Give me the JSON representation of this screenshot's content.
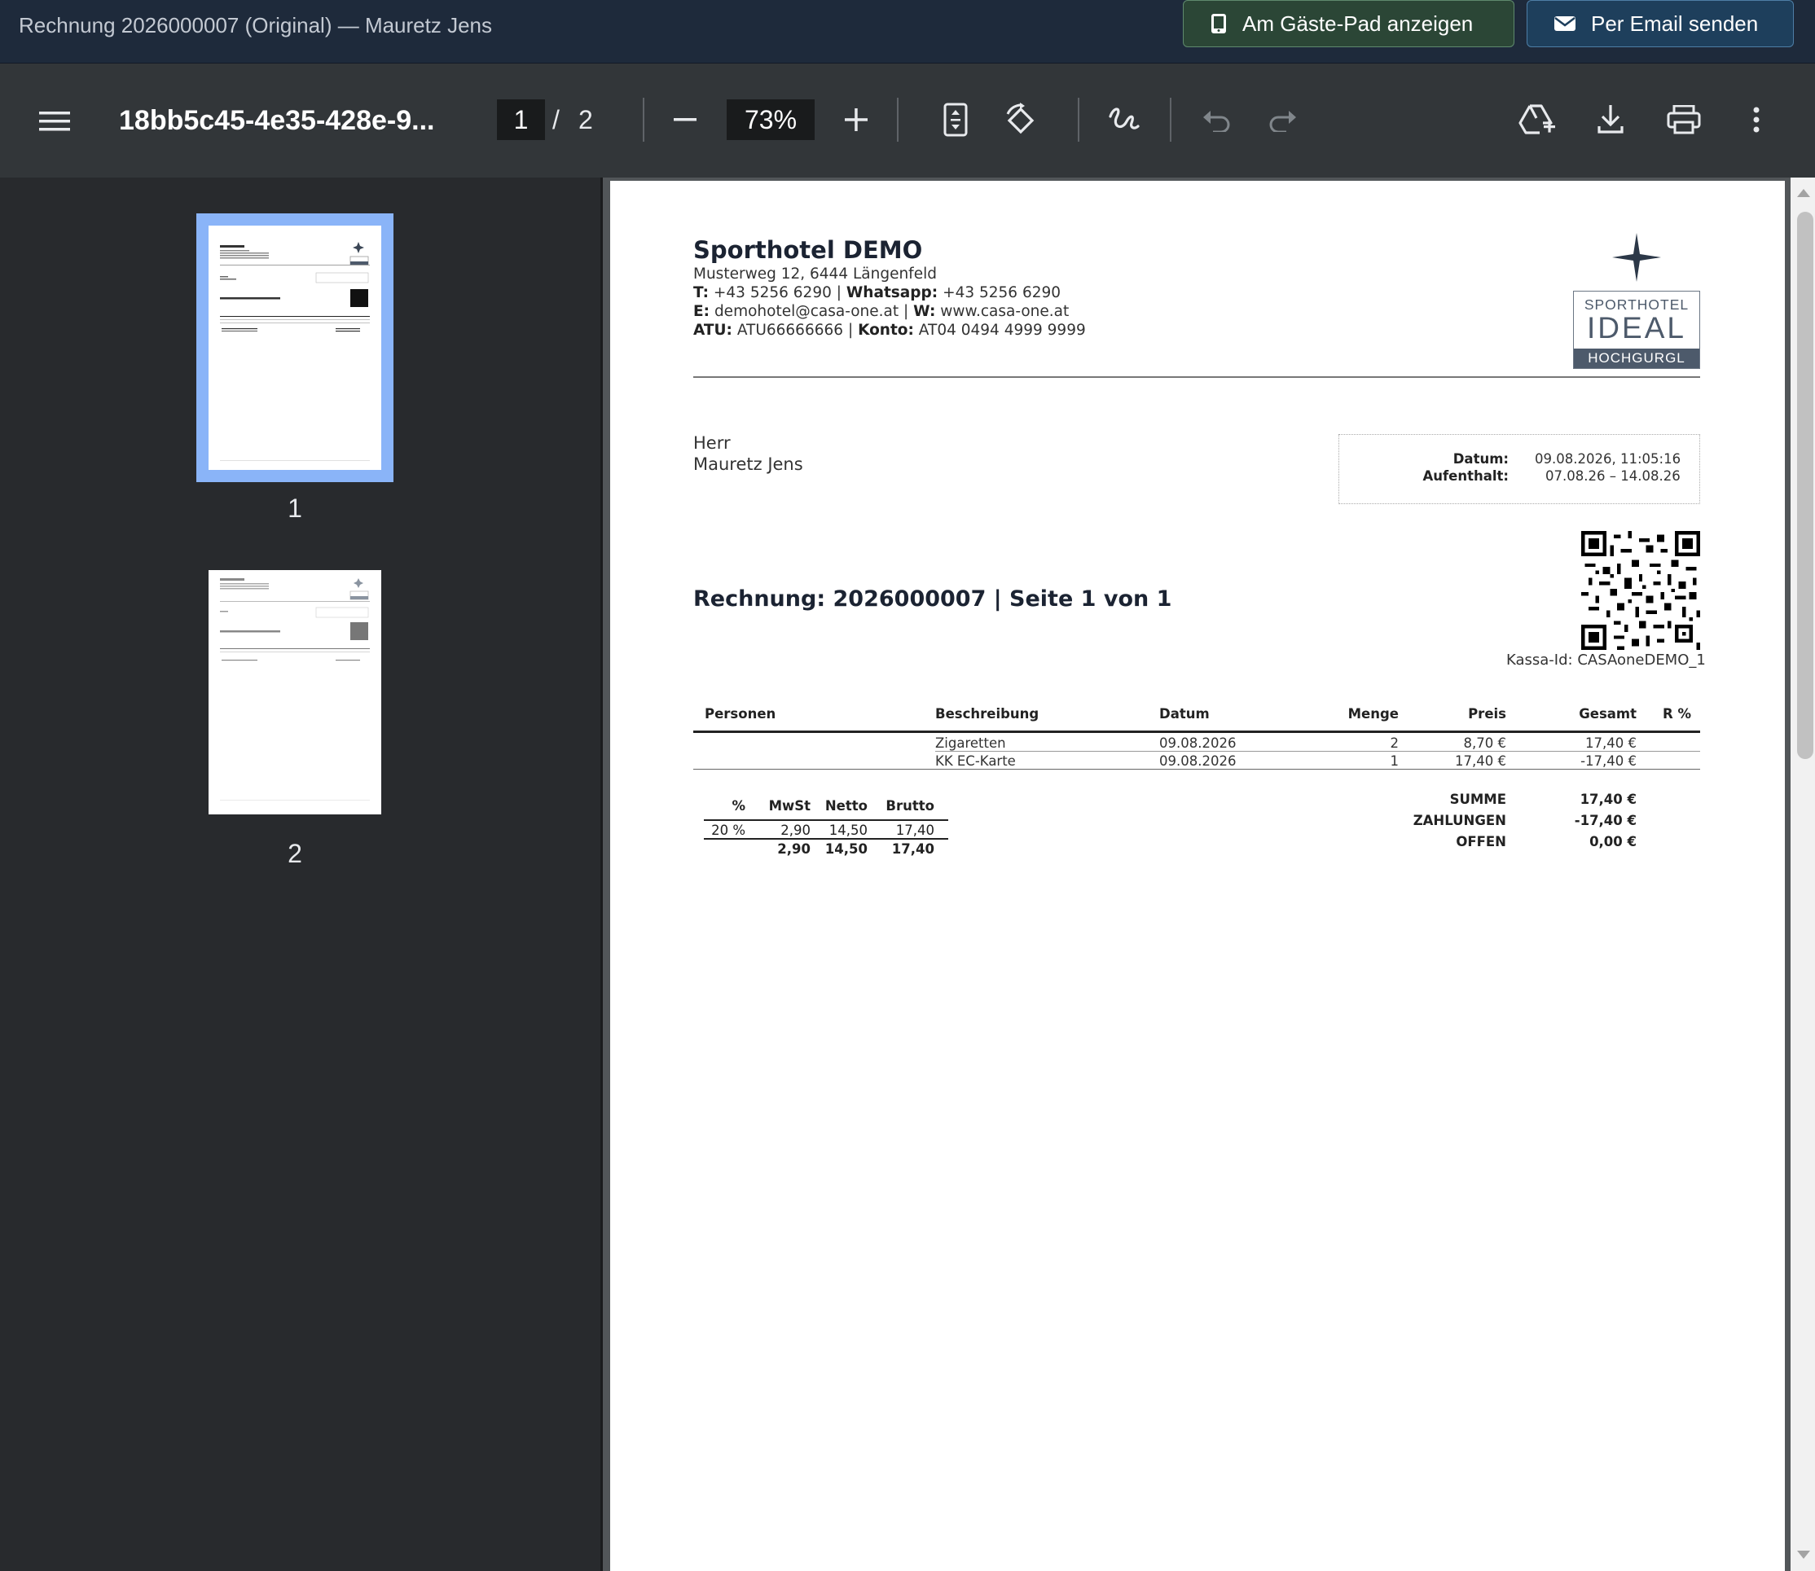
{
  "window": {
    "title": "Rechnung 2026000007 (Original) — Mauretz Jens",
    "buttons": {
      "guest_pad": "Am Gäste-Pad anzeigen",
      "email": "Per Email senden"
    }
  },
  "toolbar": {
    "doc_name": "18bb5c45-4e35-428e-9...",
    "current_page": "1",
    "page_separator": "/",
    "total_pages": "2",
    "zoom": "73%"
  },
  "sidebar": {
    "thumbnails": [
      {
        "label": "1",
        "selected": true
      },
      {
        "label": "2",
        "selected": false
      }
    ]
  },
  "invoice": {
    "hotel_name": "Sporthotel DEMO",
    "address": "Musterweg 12, 6444 Längenfeld",
    "phone_label": "T:",
    "phone": "+43 5256 6290",
    "whatsapp_label": "Whatsapp:",
    "whatsapp": "+43 5256 6290",
    "email_label": "E:",
    "email": "demohotel@casa-one.at",
    "web_label": "W:",
    "web": "www.casa-one.at",
    "atu_label": "ATU:",
    "atu": "ATU66666666",
    "konto_label": "Konto:",
    "konto": "AT04 0494 4999 9999",
    "sep": "|",
    "logo": {
      "line1": "SPORTHOTEL",
      "line2": "IDEAL",
      "line3": "HOCHGURGL"
    },
    "salutation": "Herr",
    "guest_name": "Mauretz Jens",
    "datum_label": "Datum:",
    "datum": "09.08.2026, 11:05:16",
    "aufenthalt_label": "Aufenthalt:",
    "aufenthalt": "07.08.26 – 14.08.26",
    "kassa": "Kassa-Id: CASAoneDEMO_1",
    "title": "Rechnung: 2026000007 | Seite 1 von 1",
    "columns": {
      "personen": "Personen",
      "beschreibung": "Beschreibung",
      "datum": "Datum",
      "menge": "Menge",
      "preis": "Preis",
      "gesamt": "Gesamt",
      "rabatt": "R %"
    },
    "rows": [
      {
        "personen": "",
        "beschreibung": "Zigaretten",
        "datum": "09.08.2026",
        "menge": "2",
        "preis": "8,70 €",
        "gesamt": "17,40 €",
        "rabatt": ""
      },
      {
        "personen": "",
        "beschreibung": "KK EC-Karte",
        "datum": "09.08.2026",
        "menge": "1",
        "preis": "17,40 €",
        "gesamt": "-17,40 €",
        "rabatt": ""
      }
    ],
    "tax": {
      "headers": {
        "pct": "%",
        "mwst": "MwSt",
        "netto": "Netto",
        "brutto": "Brutto"
      },
      "row": {
        "pct": "20 %",
        "mwst": "2,90",
        "netto": "14,50",
        "brutto": "17,40"
      },
      "total": {
        "mwst": "2,90",
        "netto": "14,50",
        "brutto": "17,40"
      }
    },
    "totals": {
      "summe_label": "SUMME",
      "summe": "17,40 €",
      "zahlungen_label": "ZAHLUNGEN",
      "zahlungen": "-17,40 €",
      "offen_label": "OFFEN",
      "offen": "0,00 €"
    }
  },
  "colors": {
    "titlebar_bg": "#1e2a3b",
    "guest_pad_button": "#2b4636",
    "email_button": "#1e3f5c",
    "toolbar_bg": "#323639",
    "thumbnail_selected": "#8ab4f8",
    "logo_band": "#4d5a6b"
  },
  "icons": {
    "guest_pad": "tablet-icon",
    "email": "envelope-icon",
    "menu": "hamburger-icon",
    "zoom_out": "minus-icon",
    "zoom_in": "plus-icon",
    "fit": "fit-page-icon",
    "rotate": "rotate-icon",
    "annotate": "draw-icon",
    "undo": "undo-icon",
    "redo": "redo-icon",
    "drive": "add-to-drive-icon",
    "download": "download-icon",
    "print": "print-icon",
    "more": "more-vert-icon"
  }
}
